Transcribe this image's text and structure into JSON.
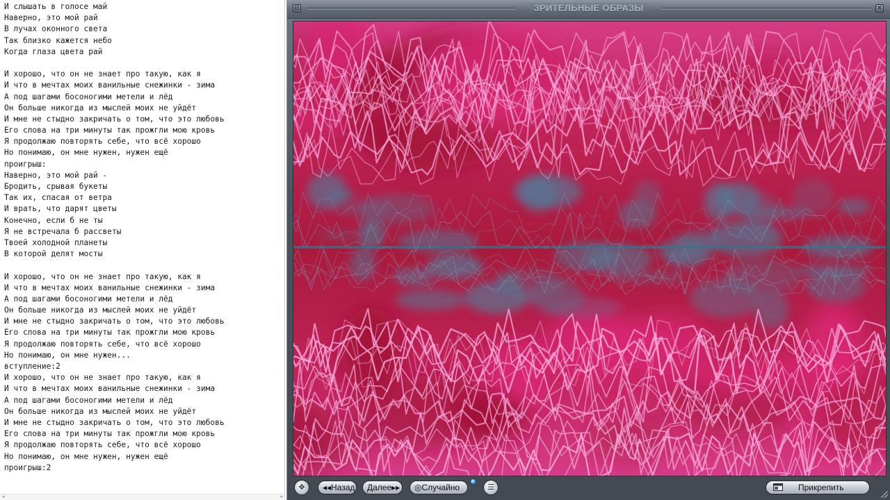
{
  "editor": {
    "lines": [
      "И слышать в голосе май",
      "Наверно, это мой рай",
      "В лучах оконного света",
      "Так близко кажется небо",
      "Когда глаза цвета рай",
      "",
      "И хорошо, что он не знает про такую, как я",
      "И что в мечтах моих ванильные снежинки - зима",
      "А под шагами босоногими метели и лёд",
      "Он больше никогда из мыслей моих не уйдёт",
      "И мне не стыдно закричать о том, что это любовь",
      "Его слова на три минуты так прожгли мою кровь",
      "Я продолжаю повторять себе, что всё хорошо",
      "Но понимаю, он мне нужен, нужен ещё",
      "проигрыш:",
      "Наверно, это мой рай -",
      "Бродить, срывая букеты",
      "Так их, спасая от ветра",
      "И врать, что дарят цветы",
      "Конечно, если б не ты",
      "Я не встречала б рассветы",
      "Твоей холодной планеты",
      "В которой делят мосты",
      "",
      "И хорошо, что он не знает про такую, как я",
      "И что в мечтах моих ванильные снежинки - зима",
      "А под шагами босоногими метели и лёд",
      "Он больше никогда из мыслей моих не уйдёт",
      "И мне не стыдно закричать о том, что это любовь",
      "Его слова на три минуты так прожгли мою кровь",
      "Я продолжаю повторять себе, что всё хорошо",
      "Но понимаю, он мне нужен...",
      "вступление:2",
      "И хорошо, что он не знает про такую, как я",
      "И что в мечтах моих ванильные снежинки - зима",
      "А под шагами босоногими метели и лёд",
      "Он больше никогда из мыслей моих не уйдёт",
      "И мне не стыдно закричать о том, что это любовь",
      "Его слова на три минуты так прожгли мою кровь",
      "Я продолжаю повторять себе, что всё хорошо",
      "Но понимаю, он мне нужен, нужен ещё",
      "проигрыш:2"
    ]
  },
  "visualizer": {
    "title": "ЗРИТЕЛЬНЫЕ ОБРАЗЫ",
    "colors": {
      "base": "#b41a4c",
      "bright": "#e0287a",
      "wave": "#f6a8dc",
      "cool": "#4f7f9c"
    },
    "controls": {
      "back_label": "◂◂Назад",
      "next_label": "Далее▸▸",
      "random_label": "◎Случайно",
      "pin_label": "Прикрепить"
    }
  }
}
